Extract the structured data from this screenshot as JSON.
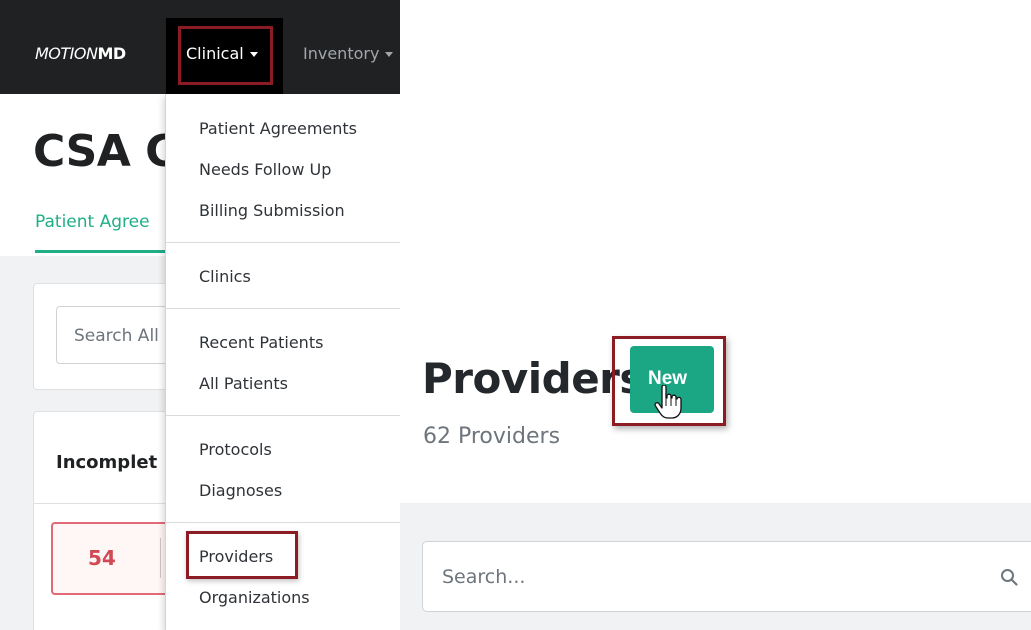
{
  "navbar": {
    "brand_part1": "MOTION",
    "brand_part2": "MD",
    "clinical_label": "Clinical",
    "inventory_label": "Inventory"
  },
  "left_page": {
    "heading": "CSA C",
    "tab_label": "Patient Agree",
    "search_placeholder": "Search All",
    "card_title": "Incomplet",
    "count": "54"
  },
  "dropdown": {
    "items": [
      {
        "label": "Patient Agreements"
      },
      {
        "label": "Needs Follow Up"
      },
      {
        "label": "Billing Submission"
      },
      {
        "label": "Clinics"
      },
      {
        "label": "Recent Patients"
      },
      {
        "label": "All Patients"
      },
      {
        "label": "Protocols"
      },
      {
        "label": "Diagnoses"
      },
      {
        "label": "Providers"
      },
      {
        "label": "Organizations"
      }
    ]
  },
  "providers_page": {
    "title": "Providers",
    "count_text": "62 Providers",
    "new_label": "New",
    "search_placeholder": "Search..."
  },
  "colors": {
    "accent": "#1fae86",
    "highlight": "#8b1c24",
    "navbar": "#1f2123",
    "badge_red": "#d04a55"
  },
  "icons": [
    "chevron-down-icon",
    "search-icon",
    "hand-pointer-icon"
  ]
}
